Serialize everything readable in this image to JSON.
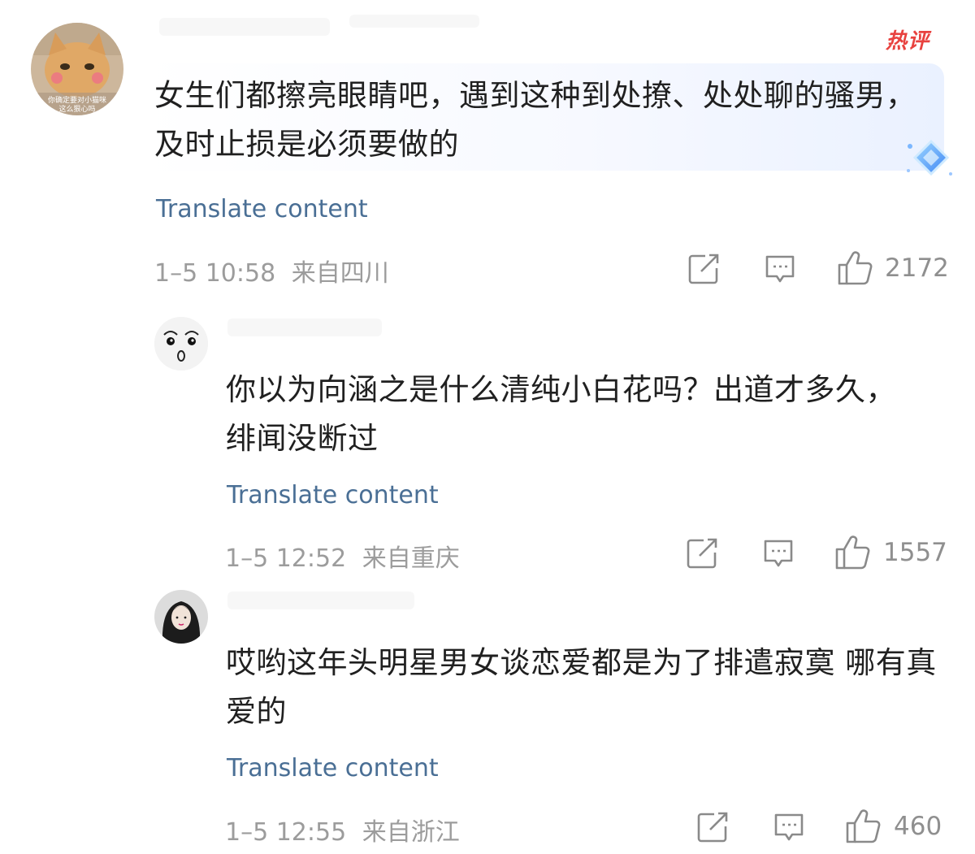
{
  "comments": [
    {
      "badge": "热评",
      "avatar_caption": "你确定要对小猫咪这么狠心吗",
      "text": "女生们都擦亮眼睛吧，遇到这种到处撩、处处聊的骚男，及时止损是必须要做的",
      "translate_label": "Translate content",
      "time": "1–5 10:58",
      "location": "来自四川",
      "likes": "2172"
    },
    {
      "text": "你以为向涵之是什么清纯小白花吗？出道才多久，绯闻没断过",
      "translate_label": "Translate content",
      "time": "1–5 12:52",
      "location": "来自重庆",
      "likes": "1557"
    },
    {
      "text": "哎哟这年头明星男女谈恋爱都是为了排遣寂寞 哪有真爱的",
      "translate_label": "Translate content",
      "time": "1–5 12:55",
      "location": "来自浙江",
      "likes": "460"
    }
  ],
  "icons": {
    "share": "share-icon",
    "reply": "comment-icon",
    "like": "thumbs-up-icon",
    "badge_decoration": "diamond-icon"
  },
  "colors": {
    "hot_tag": "#e8423f",
    "translate_link": "#4a6f95",
    "meta_text": "#9c9c9c"
  }
}
